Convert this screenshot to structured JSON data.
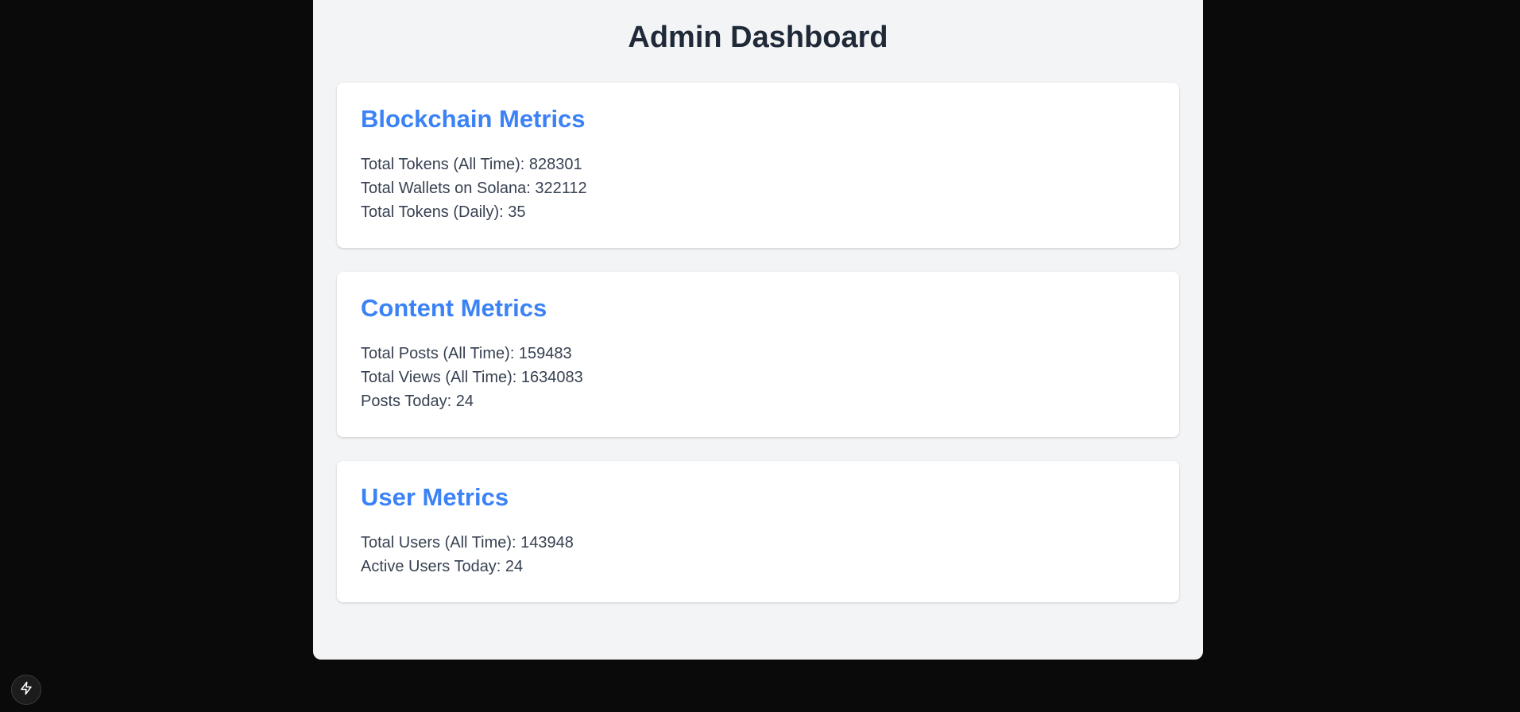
{
  "page": {
    "title": "Admin Dashboard"
  },
  "colors": {
    "background": "#0a0a0a",
    "panel": "#f3f4f6",
    "card": "#ffffff",
    "accent": "#3b82f6",
    "heading": "#1f2937",
    "text": "#374151"
  },
  "blockchain": {
    "title": "Blockchain Metrics",
    "items": [
      "Total Tokens (All Time): 828301",
      "Total Wallets on Solana: 322112",
      "Total Tokens (Daily): 35"
    ]
  },
  "content": {
    "title": "Content Metrics",
    "items": [
      "Total Posts (All Time): 159483",
      "Total Views (All Time): 1634083",
      "Posts Today: 24"
    ]
  },
  "users": {
    "title": "User Metrics",
    "items": [
      "Total Users (All Time): 143948",
      "Active Users Today: 24"
    ]
  },
  "dev_indicator": {
    "icon": "lightning-bolt-icon"
  }
}
